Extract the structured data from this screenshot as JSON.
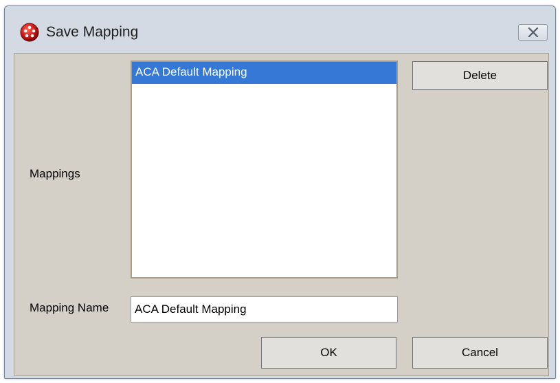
{
  "window": {
    "title": "Save Mapping",
    "close_label": "close",
    "icon": "red-orb-app-icon"
  },
  "form": {
    "mappings_label": "Mappings",
    "mappings": [
      {
        "label": "ACA Default Mapping",
        "selected": true
      }
    ],
    "mapping_name_label": "Mapping Name",
    "mapping_name_value": "ACA Default Mapping"
  },
  "buttons": {
    "delete": "Delete",
    "ok": "OK",
    "cancel": "Cancel"
  },
  "colors": {
    "selection": "#3578d6",
    "dialog_bg": "#d4d0c8",
    "titlebar_bg": "#d3dae4"
  }
}
